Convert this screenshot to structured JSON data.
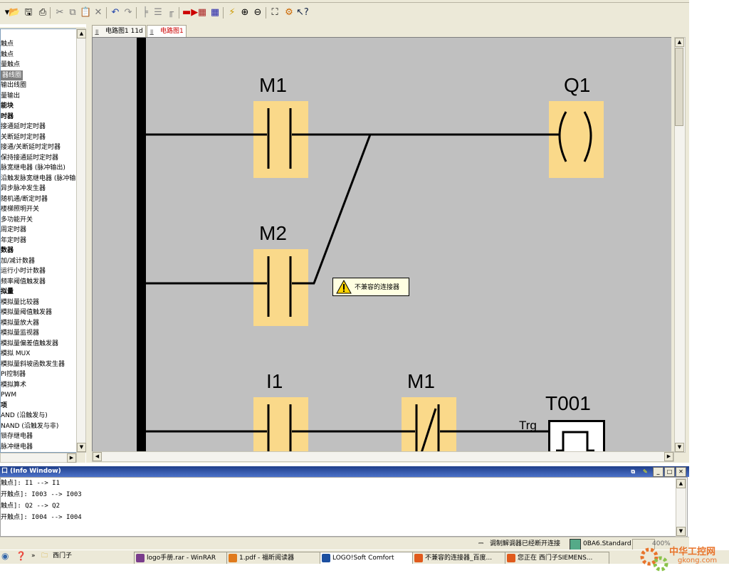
{
  "toolbar": {
    "icons": [
      "dropdown-icon",
      "open-icon",
      "save-icon",
      "print-icon",
      "cut-icon",
      "copy-icon",
      "paste-icon",
      "delete-icon",
      "undo-icon",
      "redo-icon",
      "split-icon",
      "join-icon",
      "network-icon",
      "run-icon",
      "transfer-pc-icon",
      "transfer-logo-icon",
      "connect-icon",
      "zoom-in-icon",
      "zoom-out-icon",
      "fit-icon",
      "properties-icon",
      "help-icon"
    ]
  },
  "palette": {
    "items": [
      {
        "label": "触点",
        "bold": false
      },
      {
        "label": "触点",
        "bold": false
      },
      {
        "label": "量触点",
        "bold": false
      },
      {
        "label": "器线圈",
        "bold": false,
        "selected": true
      },
      {
        "label": "输出线圈",
        "bold": false
      },
      {
        "label": "量输出",
        "bold": false
      },
      {
        "label": "能块",
        "bold": true
      },
      {
        "label": "时器",
        "bold": true
      },
      {
        "label": "接通延时定时器",
        "bold": false
      },
      {
        "label": "关断延时定时器",
        "bold": false
      },
      {
        "label": "接通/关断延时定时器",
        "bold": false
      },
      {
        "label": "保持接通延时定时器",
        "bold": false
      },
      {
        "label": "脉宽继电器 (脉冲输出)",
        "bold": false
      },
      {
        "label": "沿触发脉宽继电器 (脉冲输",
        "bold": false
      },
      {
        "label": "异步脉冲发生器",
        "bold": false
      },
      {
        "label": "随机通/断定时器",
        "bold": false
      },
      {
        "label": "楼梯照明开关",
        "bold": false
      },
      {
        "label": "多功能开关",
        "bold": false
      },
      {
        "label": "周定时器",
        "bold": false
      },
      {
        "label": "年定时器",
        "bold": false
      },
      {
        "label": "数器",
        "bold": true
      },
      {
        "label": "加/减计数器",
        "bold": false
      },
      {
        "label": "运行小时计数器",
        "bold": false
      },
      {
        "label": "频率阈值触发器",
        "bold": false
      },
      {
        "label": "拟量",
        "bold": true
      },
      {
        "label": "模拟量比较器",
        "bold": false
      },
      {
        "label": "模拟量阈值触发器",
        "bold": false
      },
      {
        "label": "模拟量放大器",
        "bold": false
      },
      {
        "label": "模拟量监视器",
        "bold": false
      },
      {
        "label": "模拟量偏差值触发器",
        "bold": false
      },
      {
        "label": "模拟 MUX",
        "bold": false
      },
      {
        "label": "模拟量斜坡函数发生器",
        "bold": false
      },
      {
        "label": "PI控制器",
        "bold": false
      },
      {
        "label": "模拟算术",
        "bold": false
      },
      {
        "label": "PWM",
        "bold": false
      },
      {
        "label": "项",
        "bold": true
      },
      {
        "label": "AND (沿触发与)",
        "bold": false
      },
      {
        "label": "NAND (沿触发与非)",
        "bold": false
      },
      {
        "label": "锁存继电器",
        "bold": false
      },
      {
        "label": "脉冲继电器",
        "bold": false
      }
    ]
  },
  "editor": {
    "tabs": [
      {
        "label": "电路图1 11d",
        "active": false
      },
      {
        "label": "电路图1",
        "active": true
      }
    ],
    "blocks": {
      "m1_label": "M1",
      "m2_label": "M2",
      "q1_label": "Q1",
      "i1_label": "I1",
      "m1b_label": "M1",
      "t001_label": "T001",
      "trg_label": "Trg"
    },
    "warning": "不兼容的连接器"
  },
  "info_window": {
    "title": "口 (Info Window)",
    "lines": [
      "触点]: I1 --> I1",
      "开触点]: I003 --> I003",
      "触点]: Q2 --> Q2",
      "开触点]: I004 --> I004"
    ]
  },
  "status": {
    "modem": "调制解调器已经断开连接",
    "device": "0BA6.Standard",
    "zoom": "400%"
  },
  "taskbar": {
    "quick_arrow": "»",
    "folder": "西门子",
    "tasks": [
      {
        "label": "logo手册.rar - WinRAR"
      },
      {
        "label": "1.pdf - 福昕阅读器"
      },
      {
        "label": "LOGO!Soft Comfort"
      },
      {
        "label": "不兼容的连接器_百度..."
      },
      {
        "label": "您正在 西门子SIEMENS..."
      }
    ]
  },
  "watermark": {
    "name": "中华工控网",
    "url": "gkong.com"
  }
}
